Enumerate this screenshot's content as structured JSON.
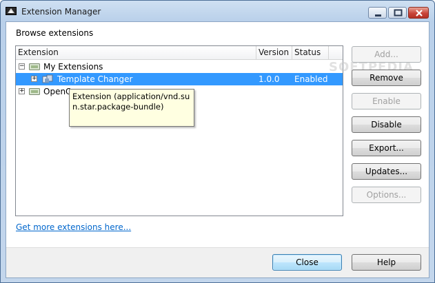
{
  "window": {
    "title": "Extension Manager"
  },
  "main": {
    "section_label": "Browse extensions",
    "columns": {
      "extension": "Extension",
      "version": "Version",
      "status": "Status"
    },
    "tree": [
      {
        "label": "My Extensions",
        "expander": "−",
        "version": "",
        "status": ""
      },
      {
        "label": "Template Changer",
        "expander": "+",
        "version": "1.0.0",
        "status": "Enabled",
        "selected": true
      },
      {
        "label": "OpenO",
        "expander": "+",
        "version": "",
        "status": ""
      }
    ],
    "tooltip": "Extension (application/vnd.sun.star.package-bundle)",
    "link": "Get more extensions here..."
  },
  "buttons": {
    "add": "Add...",
    "remove": "Remove",
    "enable": "Enable",
    "disable": "Disable",
    "export": "Export...",
    "updates": "Updates...",
    "options": "Options...",
    "close": "Close",
    "help": "Help"
  },
  "watermark": "SOFTPEDIA",
  "colors": {
    "selection": "#3399ff",
    "link": "#0066cc",
    "tooltip_bg": "#ffffe1"
  },
  "icons": [
    "extension-manager-icon",
    "minimize-icon",
    "maximize-icon",
    "close-icon",
    "folder-icon",
    "extension-package-icon"
  ]
}
